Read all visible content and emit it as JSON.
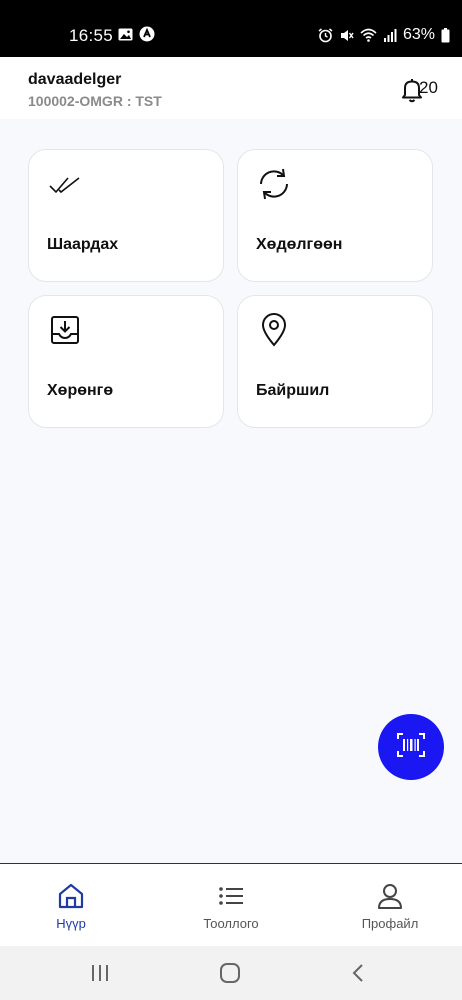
{
  "status_bar": {
    "time": "16:55",
    "battery": "63%"
  },
  "header": {
    "username": "davaadelger",
    "org_code": "100002-OMGR : TST",
    "notification_count": "20"
  },
  "tiles": [
    {
      "label": "Шаардах",
      "icon": "double-check-icon"
    },
    {
      "label": "Хөдөлгөөн",
      "icon": "sync-icon"
    },
    {
      "label": "Хөрөнгө",
      "icon": "inbox-download-icon"
    },
    {
      "label": "Байршил",
      "icon": "location-pin-icon"
    }
  ],
  "fab": {
    "icon": "barcode-scan-icon"
  },
  "bottom_nav": [
    {
      "label": "Нүүр",
      "icon": "home-icon",
      "active": true
    },
    {
      "label": "Тооллого",
      "icon": "list-icon",
      "active": false
    },
    {
      "label": "Профайл",
      "icon": "user-icon",
      "active": false
    }
  ],
  "colors": {
    "accent": "#1a17f2",
    "active_nav": "#1f3aa6",
    "background": "#f7f9fc"
  }
}
